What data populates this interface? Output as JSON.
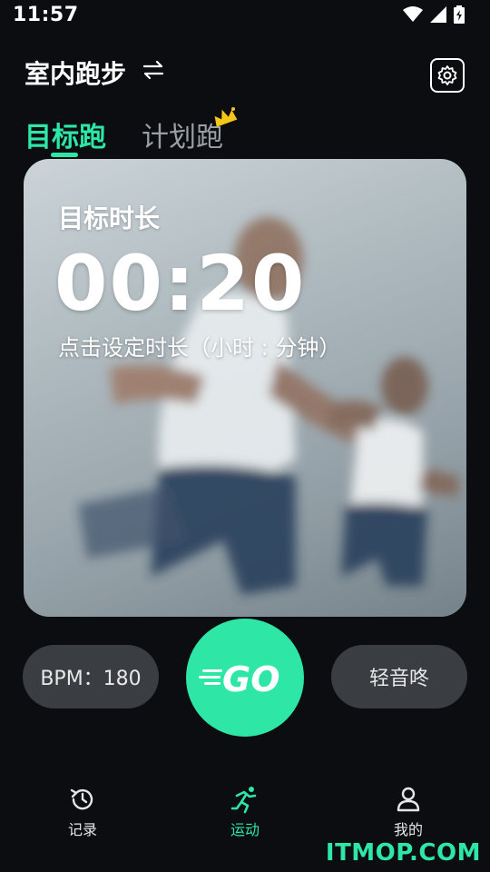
{
  "status_bar": {
    "time": "11:57",
    "icons": [
      "wifi-icon",
      "signal-icon",
      "battery-icon"
    ]
  },
  "header": {
    "title": "室内跑步",
    "swap_icon": "swap-icon",
    "settings_icon": "gear-icon"
  },
  "tabs": [
    {
      "label": "目标跑",
      "active": true
    },
    {
      "label": "计划跑",
      "active": false,
      "badge_icon": "crown-icon"
    }
  ],
  "target_card": {
    "label": "目标时长",
    "value": "00:20",
    "hint": "点击设定时长（小时 : 分钟）"
  },
  "controls": {
    "bpm_label": "BPM：180",
    "go_label": "GO",
    "sound_label": "轻音咚"
  },
  "bottom_nav": [
    {
      "label": "记录",
      "icon": "history-icon",
      "active": false
    },
    {
      "label": "运动",
      "icon": "runner-icon",
      "active": true
    },
    {
      "label": "我的",
      "icon": "profile-icon",
      "active": false
    }
  ],
  "watermark": "ITMOP.COM",
  "colors": {
    "accent": "#2ee6a6",
    "background": "#0b0d10",
    "pill": "#3a3d42"
  }
}
